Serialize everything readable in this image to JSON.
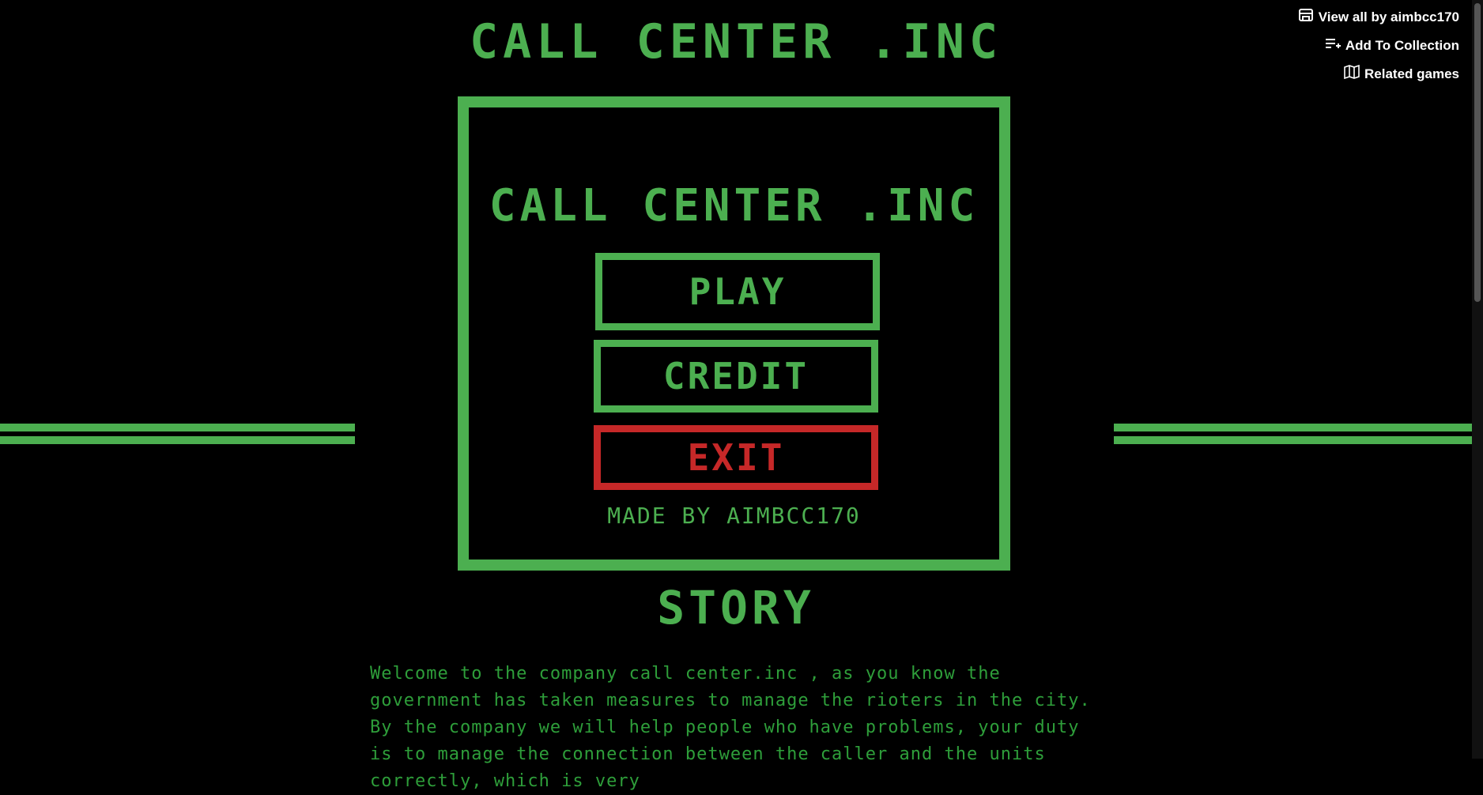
{
  "page": {
    "title": "CALL CENTER .INC"
  },
  "top_links": [
    {
      "label": "View all by aimbcc170",
      "icon": "store-icon"
    },
    {
      "label": "Add To Collection",
      "icon": "add-list-icon"
    },
    {
      "label": "Related games",
      "icon": "map-icon"
    }
  ],
  "game": {
    "title": "CALL CENTER .INC",
    "play_label": "PLAY",
    "credit_label": "CREDIT",
    "exit_label": "EXIT",
    "made_by": "MADE BY AIMBCC170"
  },
  "story": {
    "heading": "STORY",
    "text": "Welcome to the company call center.inc , as you know the government has taken measures to manage the rioters in the city. By the company we will help people who have problems, your duty is to manage the connection between the caller and the units correctly, which is very"
  },
  "colors": {
    "accent_green": "#4caf50",
    "exit_red": "#c62828",
    "background": "#000000"
  }
}
